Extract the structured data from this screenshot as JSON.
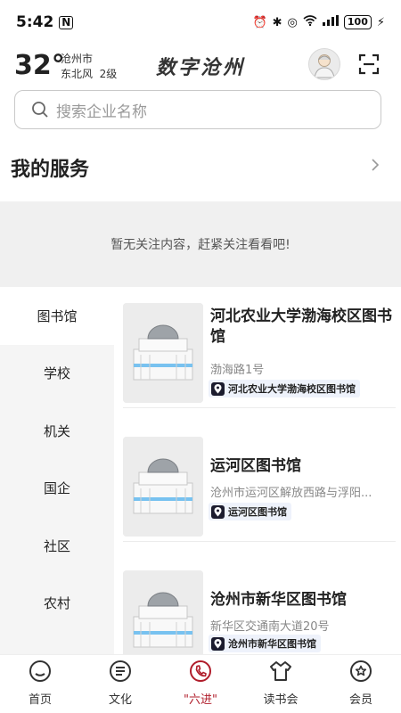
{
  "status_bar": {
    "time": "5:42",
    "battery": "100"
  },
  "header": {
    "temperature": "32°",
    "city": "沧州市",
    "wind": "东北风  2级",
    "app_title": "数字沧州"
  },
  "search": {
    "placeholder": "搜索企业名称"
  },
  "services": {
    "title": "我的服务",
    "empty_text": "暂无关注内容，赶紧关注看看吧!"
  },
  "categories": [
    {
      "label": "图书馆",
      "active": true
    },
    {
      "label": "学校"
    },
    {
      "label": "机关"
    },
    {
      "label": "国企"
    },
    {
      "label": "社区"
    },
    {
      "label": "农村"
    }
  ],
  "libraries": [
    {
      "name": "河北农业大学渤海校区图书馆",
      "address": "渤海路1号",
      "tag": "河北农业大学渤海校区图书馆"
    },
    {
      "name": "运河区图书馆",
      "address": "沧州市运河区解放西路与浮阳...",
      "tag": "运河区图书馆"
    },
    {
      "name": "沧州市新华区图书馆",
      "address": "新华区交通南大道20号",
      "tag": "沧州市新华区图书馆"
    }
  ],
  "bottom_nav": [
    {
      "label": "首页",
      "icon": "home-icon"
    },
    {
      "label": "文化",
      "icon": "culture-icon"
    },
    {
      "label": "\"六进\"",
      "icon": "phone-icon",
      "active": true
    },
    {
      "label": "读书会",
      "icon": "reading-club-icon"
    },
    {
      "label": "会员",
      "icon": "member-icon"
    }
  ],
  "colors": {
    "accent": "#b01c2a",
    "tag_background": "#eef2fb",
    "banner_background": "#f0f0f0"
  }
}
